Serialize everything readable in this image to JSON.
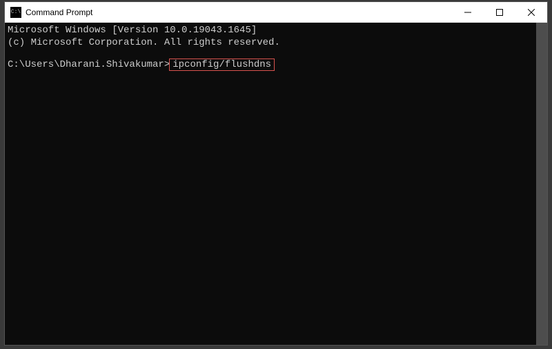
{
  "window": {
    "title": "Command Prompt",
    "icon_glyph": "C:\\"
  },
  "terminal": {
    "line1": "Microsoft Windows [Version 10.0.19043.1645]",
    "line2": "(c) Microsoft Corporation. All rights reserved.",
    "prompt": "C:\\Users\\Dharani.Shivakumar>",
    "command": "ipconfig/flushdns"
  },
  "colors": {
    "highlight_border": "#d9534f",
    "terminal_bg": "#0c0c0c",
    "terminal_fg": "#cccccc"
  }
}
